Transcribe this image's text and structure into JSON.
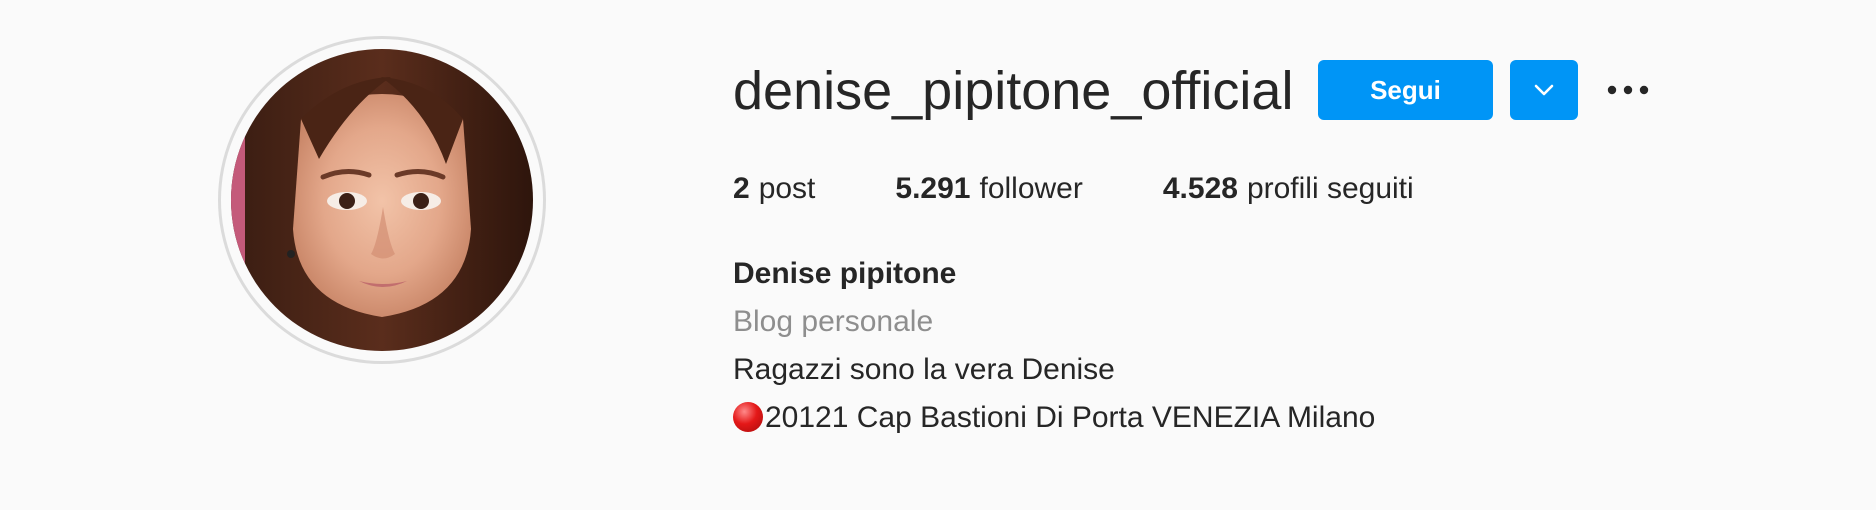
{
  "profile": {
    "username": "denise_pipitone_official",
    "follow_label": "Segui",
    "dropdown_icon": "chevron-down-icon",
    "more_icon": "more-options-icon",
    "avatar_description_icon": "profile-photo"
  },
  "stats": {
    "posts_count": "2",
    "posts_label": "post",
    "followers_count": "5.291",
    "followers_label": "follower",
    "following_count": "4.528",
    "following_label": "profili seguiti"
  },
  "bio": {
    "name": "Denise pipitone",
    "category": "Blog personale",
    "line1": "Ragazzi sono la vera Denise",
    "line2": "20121 Cap Bastioni Di Porta VENEZIA Milano"
  },
  "colors": {
    "primary_button": "#0095f6",
    "text": "#262626",
    "secondary_text": "#8e8e8e",
    "background": "#fafafa"
  }
}
